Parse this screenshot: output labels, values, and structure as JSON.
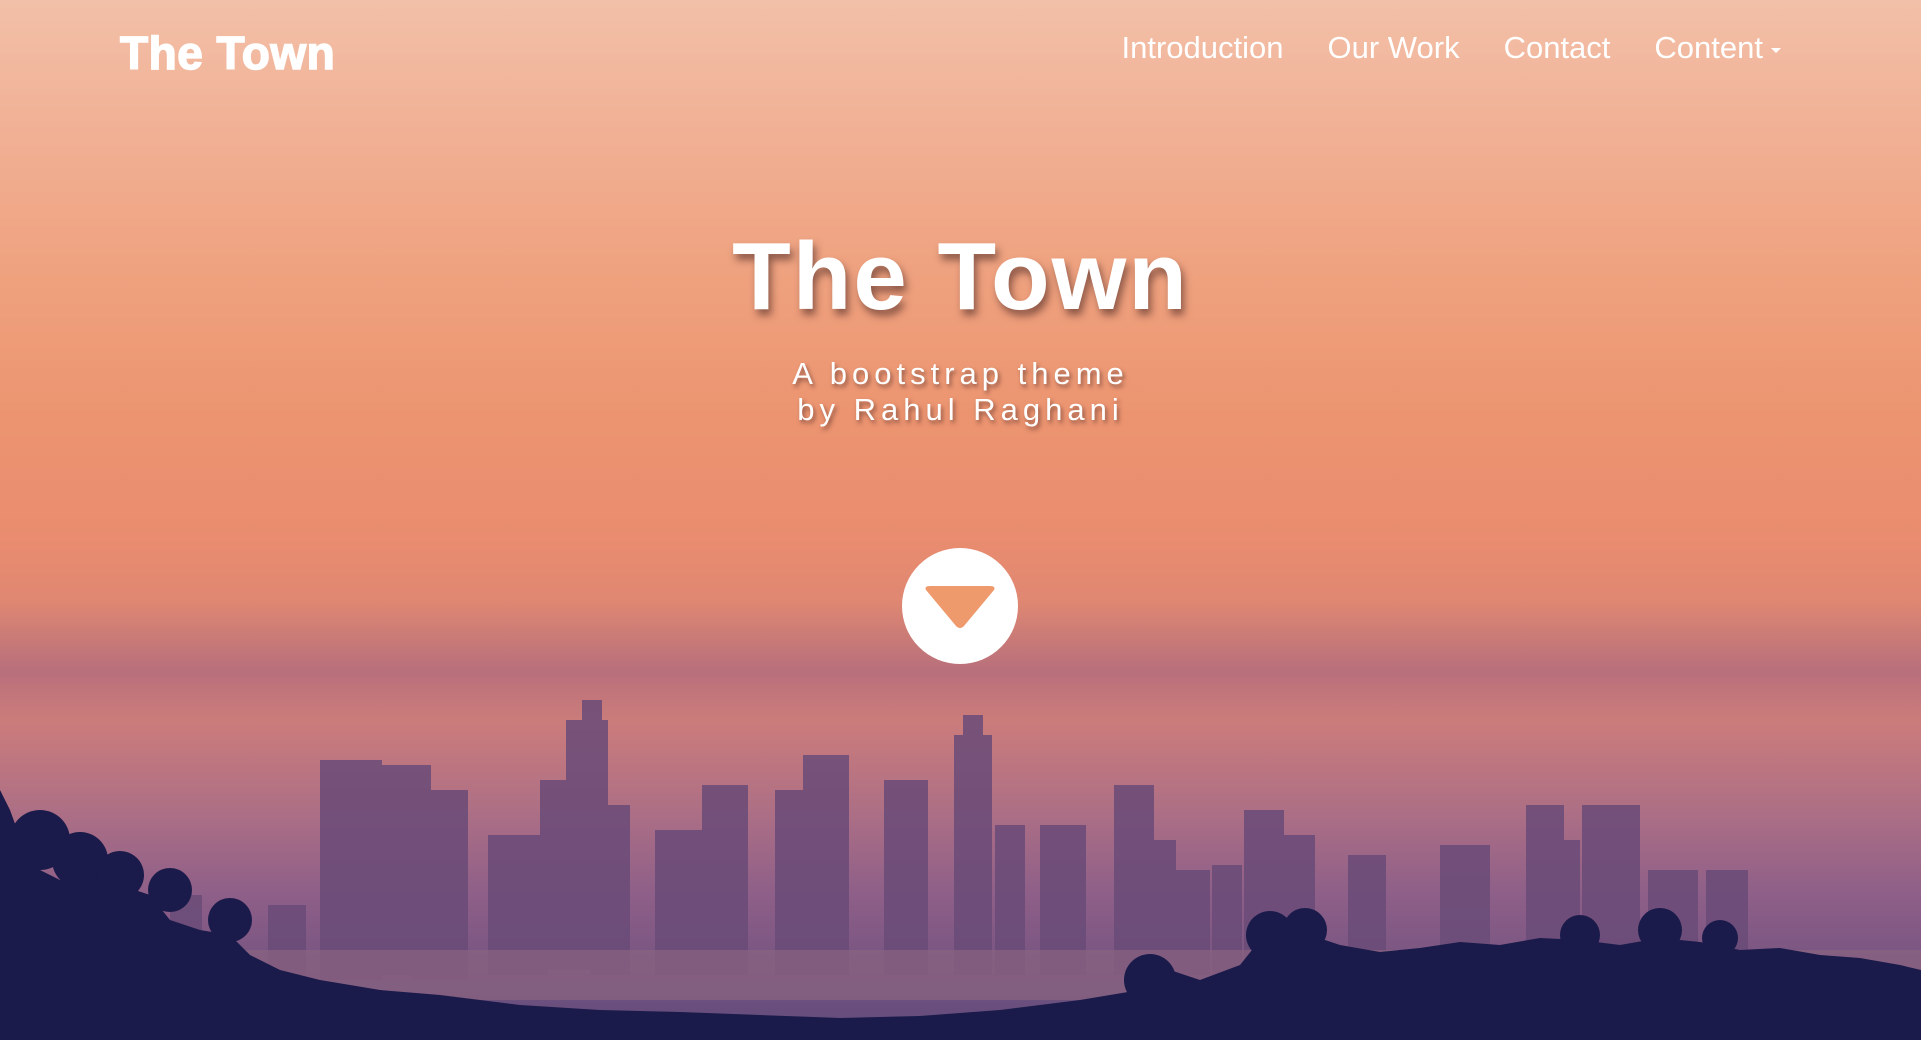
{
  "navbar": {
    "brand": "The Town",
    "links": [
      {
        "label": "Introduction"
      },
      {
        "label": "Our Work"
      },
      {
        "label": "Contact"
      },
      {
        "label": "Content",
        "has_dropdown": true
      }
    ]
  },
  "hero": {
    "title": "The Town",
    "subtitle_line1": "A bootstrap theme",
    "subtitle_line2": "by Rahul Raghani",
    "scroll_button_icon": "chevron-down-icon"
  },
  "colors": {
    "accent": "#ef9a6c",
    "text": "#ffffff",
    "silhouette": "#1a1b4a"
  }
}
